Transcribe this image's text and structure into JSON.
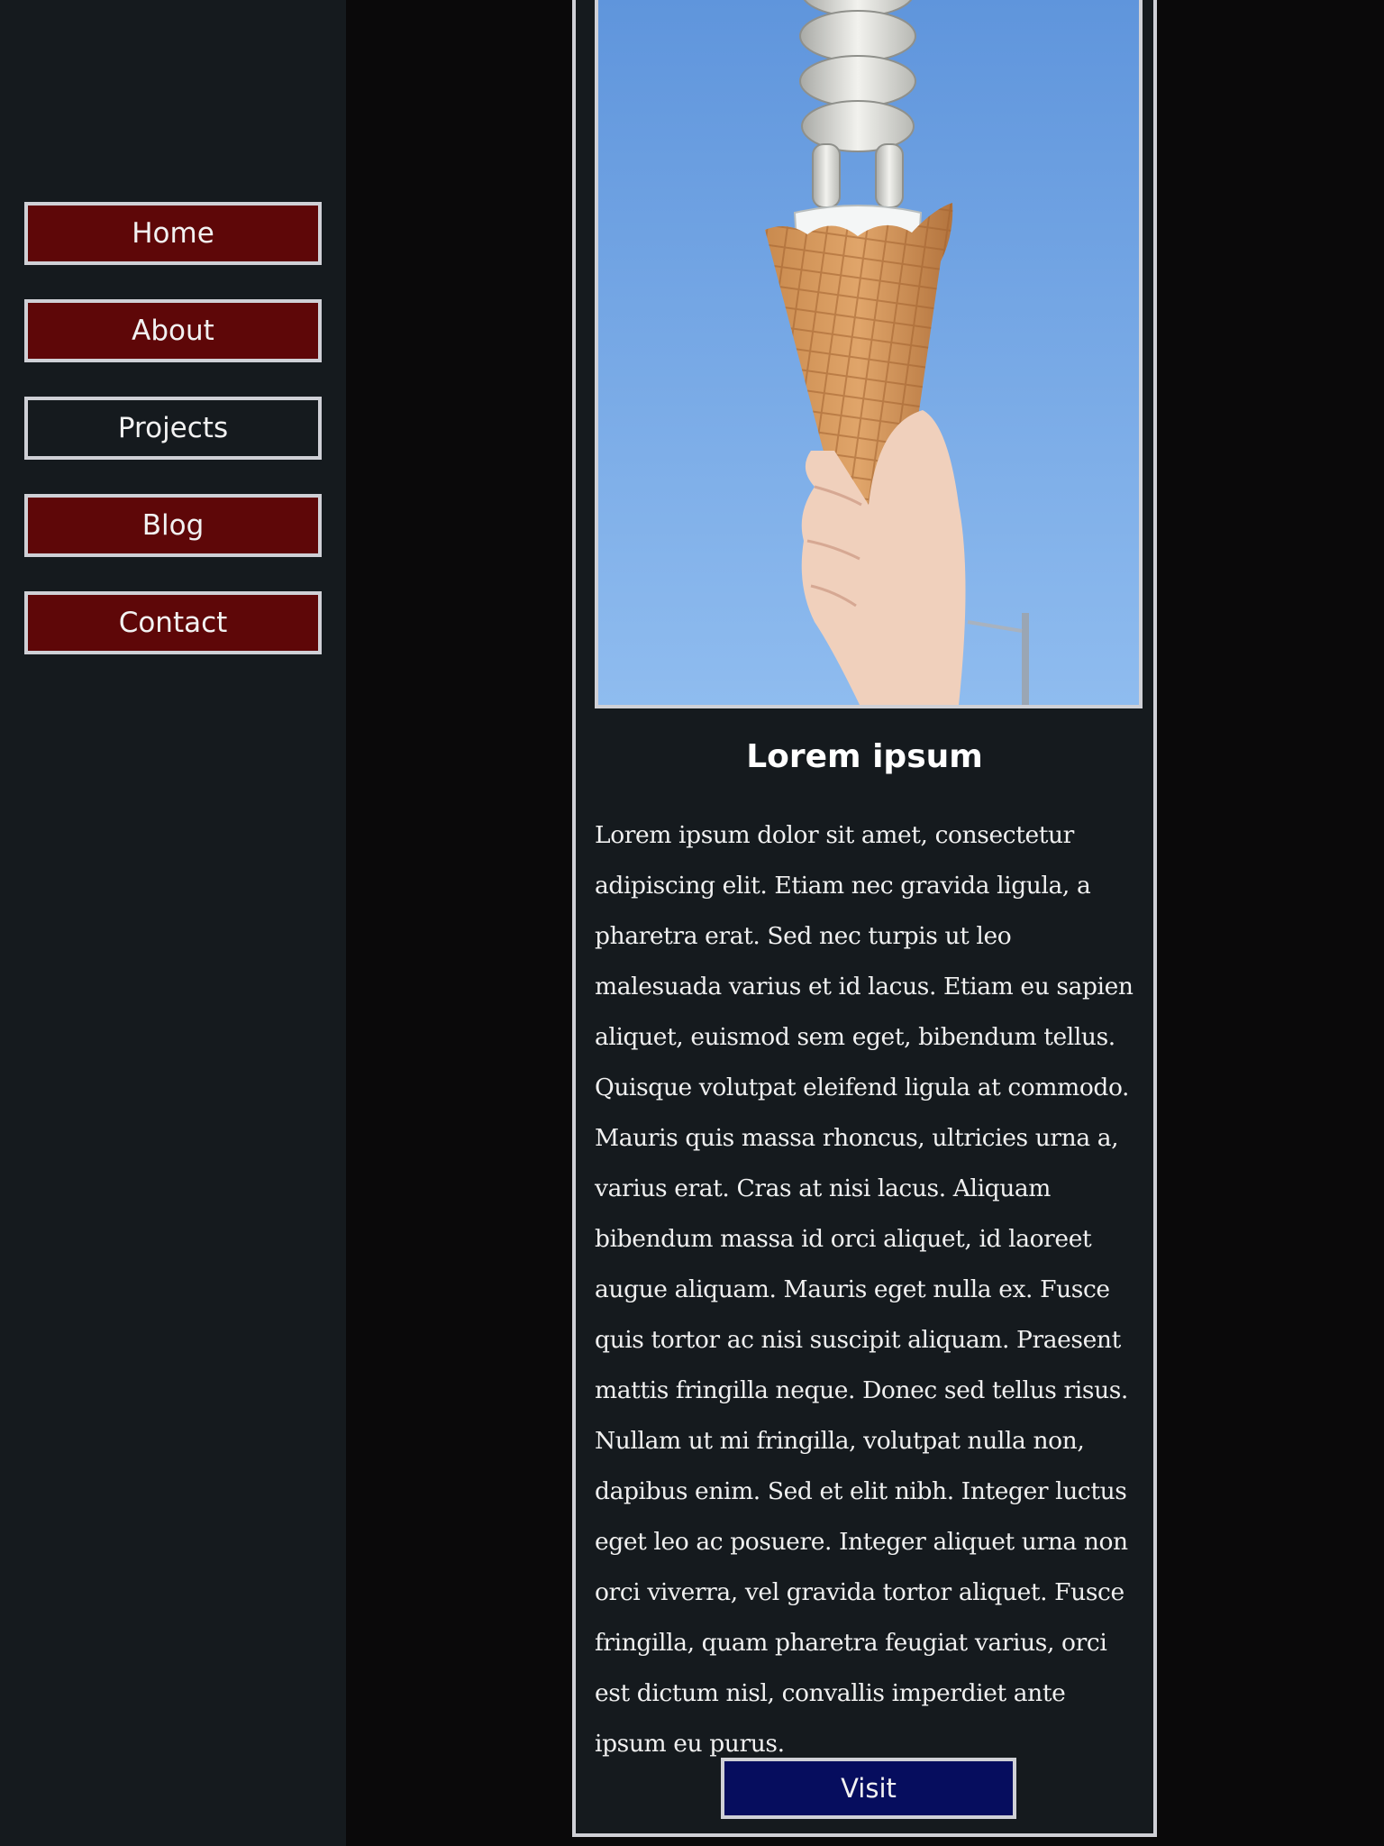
{
  "nav": {
    "items": [
      {
        "label": "Home"
      },
      {
        "label": "About"
      },
      {
        "label": "Projects"
      },
      {
        "label": "Blog"
      },
      {
        "label": "Contact"
      }
    ]
  },
  "card": {
    "title": "Lorem ipsum",
    "body": "Lorem ipsum dolor sit amet, consectetur adipiscing elit. Etiam nec gravida ligula, a pharetra erat. Sed nec turpis ut leo malesuada varius et id lacus. Etiam eu sapien aliquet, euismod sem eget, bibendum tellus. Quisque volutpat eleifend ligula at commodo. Mauris quis massa rhoncus, ultricies urna a, varius erat. Cras at nisi lacus. Aliquam bibendum massa id orci aliquet, id laoreet augue aliquam. Mauris eget nulla ex. Fusce quis tortor ac nisi suscipit aliquam. Praesent mattis fringilla neque. Donec sed tellus risus. Nullam ut mi fringilla, volutpat nulla non, dapibus enim. Sed et elit nibh. Integer luctus eget leo ac posuere. Integer aliquet urna non orci viverra, vel gravida tortor aliquet. Fusce fringilla, quam pharetra feugiat varius, orci est dictum nisl, convallis imperdiet ante ipsum eu purus.",
    "button_label": "Visit"
  },
  "colors": {
    "sidebar_bg": "#151a1e",
    "page_bg": "#0a090a",
    "nav_button_bg": "#5e0708",
    "visit_button_bg": "#060d5e",
    "border": "#cfd0d6"
  }
}
